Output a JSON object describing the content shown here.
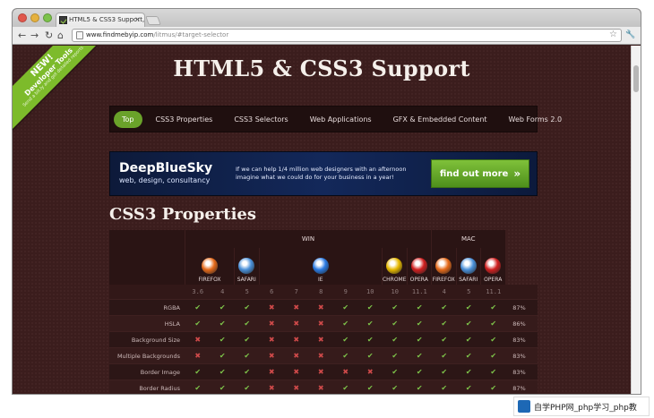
{
  "browser": {
    "tab_title": "HTML5 & CSS3 Support, We",
    "tab_close": "×",
    "url_host": "www.findmebyip.com",
    "url_path": "/litmus/#target-selector",
    "nav": {
      "back": "←",
      "forward": "→",
      "reload": "↻",
      "home": "⌂"
    },
    "star": "☆",
    "wrench": "🔧"
  },
  "ribbon": {
    "line1": "NEW!",
    "line2": "Developer Tools",
    "line3": "Send a bit.ly and get detailed reports"
  },
  "page": {
    "title": "HTML5 & CSS3 Support",
    "section_title": "CSS3 Properties"
  },
  "navbar": {
    "items": [
      {
        "label": "Top",
        "active": true
      },
      {
        "label": "CSS3 Properties"
      },
      {
        "label": "CSS3 Selectors"
      },
      {
        "label": "Web Applications"
      },
      {
        "label": "GFX & Embedded Content"
      },
      {
        "label": "Web Forms 2.0"
      }
    ]
  },
  "ad": {
    "brand": "DeepBlueSky",
    "tagline": "web, design, consultancy",
    "text": "If we can help 1/4 million web designers with an afternoon imagine what we could do for your business in a year!",
    "button": "find out more",
    "button_icon": "»"
  },
  "table": {
    "groups": [
      {
        "label": "WIN"
      },
      {
        "label": "MAC"
      }
    ],
    "browsers": [
      {
        "label": "FIREFOX",
        "icon": "firefox-icon",
        "color": "#e66a1a"
      },
      {
        "label": "SAFARI",
        "icon": "safari-icon",
        "color": "#4a90d9"
      },
      {
        "label": "IE",
        "icon": "ie-icon",
        "color": "#2a7ae2"
      },
      {
        "label": "CHROME",
        "icon": "chrome-icon",
        "color": "#e6b800"
      },
      {
        "label": "OPERA",
        "icon": "opera-icon",
        "color": "#d11f1f"
      },
      {
        "label": "FIREFOX",
        "icon": "firefox-icon",
        "color": "#e66a1a"
      },
      {
        "label": "SAFARI",
        "icon": "safari-icon",
        "color": "#4a90d9"
      },
      {
        "label": "OPERA",
        "icon": "opera-icon",
        "color": "#d11f1f"
      }
    ],
    "versions": [
      "3.6",
      "4",
      "5",
      "6",
      "7",
      "8",
      "9",
      "10",
      "10",
      "11.1",
      "4",
      "5",
      "11.1"
    ],
    "rows": [
      {
        "name": "RGBA",
        "cells": [
          "y",
          "y",
          "y",
          "n",
          "n",
          "n",
          "y",
          "y",
          "y",
          "y",
          "y",
          "y",
          "y"
        ],
        "pct": "87%"
      },
      {
        "name": "HSLA",
        "cells": [
          "y",
          "y",
          "y",
          "n",
          "n",
          "n",
          "y",
          "y",
          "y",
          "y",
          "y",
          "y",
          "y"
        ],
        "pct": "86%"
      },
      {
        "name": "Background Size",
        "cells": [
          "n",
          "y",
          "y",
          "n",
          "n",
          "n",
          "y",
          "y",
          "y",
          "y",
          "y",
          "y",
          "y"
        ],
        "pct": "83%"
      },
      {
        "name": "Multiple Backgrounds",
        "cells": [
          "n",
          "y",
          "y",
          "n",
          "n",
          "n",
          "y",
          "y",
          "y",
          "y",
          "y",
          "y",
          "y"
        ],
        "pct": "83%"
      },
      {
        "name": "Border Image",
        "cells": [
          "y",
          "y",
          "y",
          "n",
          "n",
          "n",
          "n",
          "n",
          "y",
          "y",
          "y",
          "y",
          "y"
        ],
        "pct": "83%"
      },
      {
        "name": "Border Radius",
        "cells": [
          "y",
          "y",
          "y",
          "n",
          "n",
          "n",
          "y",
          "y",
          "y",
          "y",
          "y",
          "y",
          "y"
        ],
        "pct": "87%"
      }
    ]
  },
  "watermark": {
    "text": "自学PHP网_php学习_php教"
  }
}
